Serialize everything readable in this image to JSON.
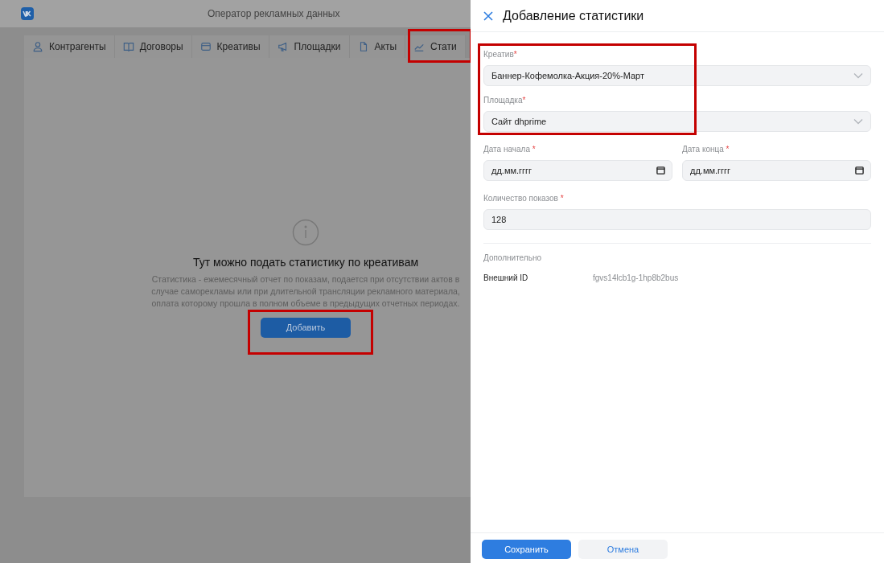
{
  "app": {
    "title": "Оператор рекламных данных"
  },
  "tabs": [
    {
      "label": "Контрагенты"
    },
    {
      "label": "Договоры"
    },
    {
      "label": "Креативы"
    },
    {
      "label": "Площадки"
    },
    {
      "label": "Акты"
    },
    {
      "label": "Стати"
    }
  ],
  "empty_state": {
    "title": "Тут можно подать статистику по креативам",
    "text": "Статистика - ежемесячный отчет по показам, подается при отсутствии актов в случае саморекламы или при длительной трансляции рекламного материала, оплата которому прошла в полном объеме в предыдущих отчетных периодах.",
    "button": "Добавить"
  },
  "panel": {
    "title": "Добавление статистики",
    "fields": [
      {
        "kind": "select",
        "label": "Креатив",
        "mark": "*",
        "value": "Баннер-Кофемолка-Акция-20%-Март"
      },
      {
        "kind": "select",
        "label": "Площадка",
        "mark": "*",
        "value": "Сайт dhprime"
      }
    ],
    "dates": [
      {
        "label": "Дата начала",
        "mark": "*",
        "placeholder": "дд.мм.гггг"
      },
      {
        "label": "Дата конца",
        "mark": "*",
        "placeholder": "дд.мм.гггг"
      }
    ],
    "count": {
      "label": "Количество показов",
      "mark": "*",
      "value": "128"
    },
    "extra": {
      "heading": "Дополнительно",
      "key": "Внешний ID",
      "value": "fgvs14lcb1g-1hp8b2bus"
    },
    "buttons": {
      "save": "Сохранить",
      "cancel": "Отмена"
    }
  }
}
